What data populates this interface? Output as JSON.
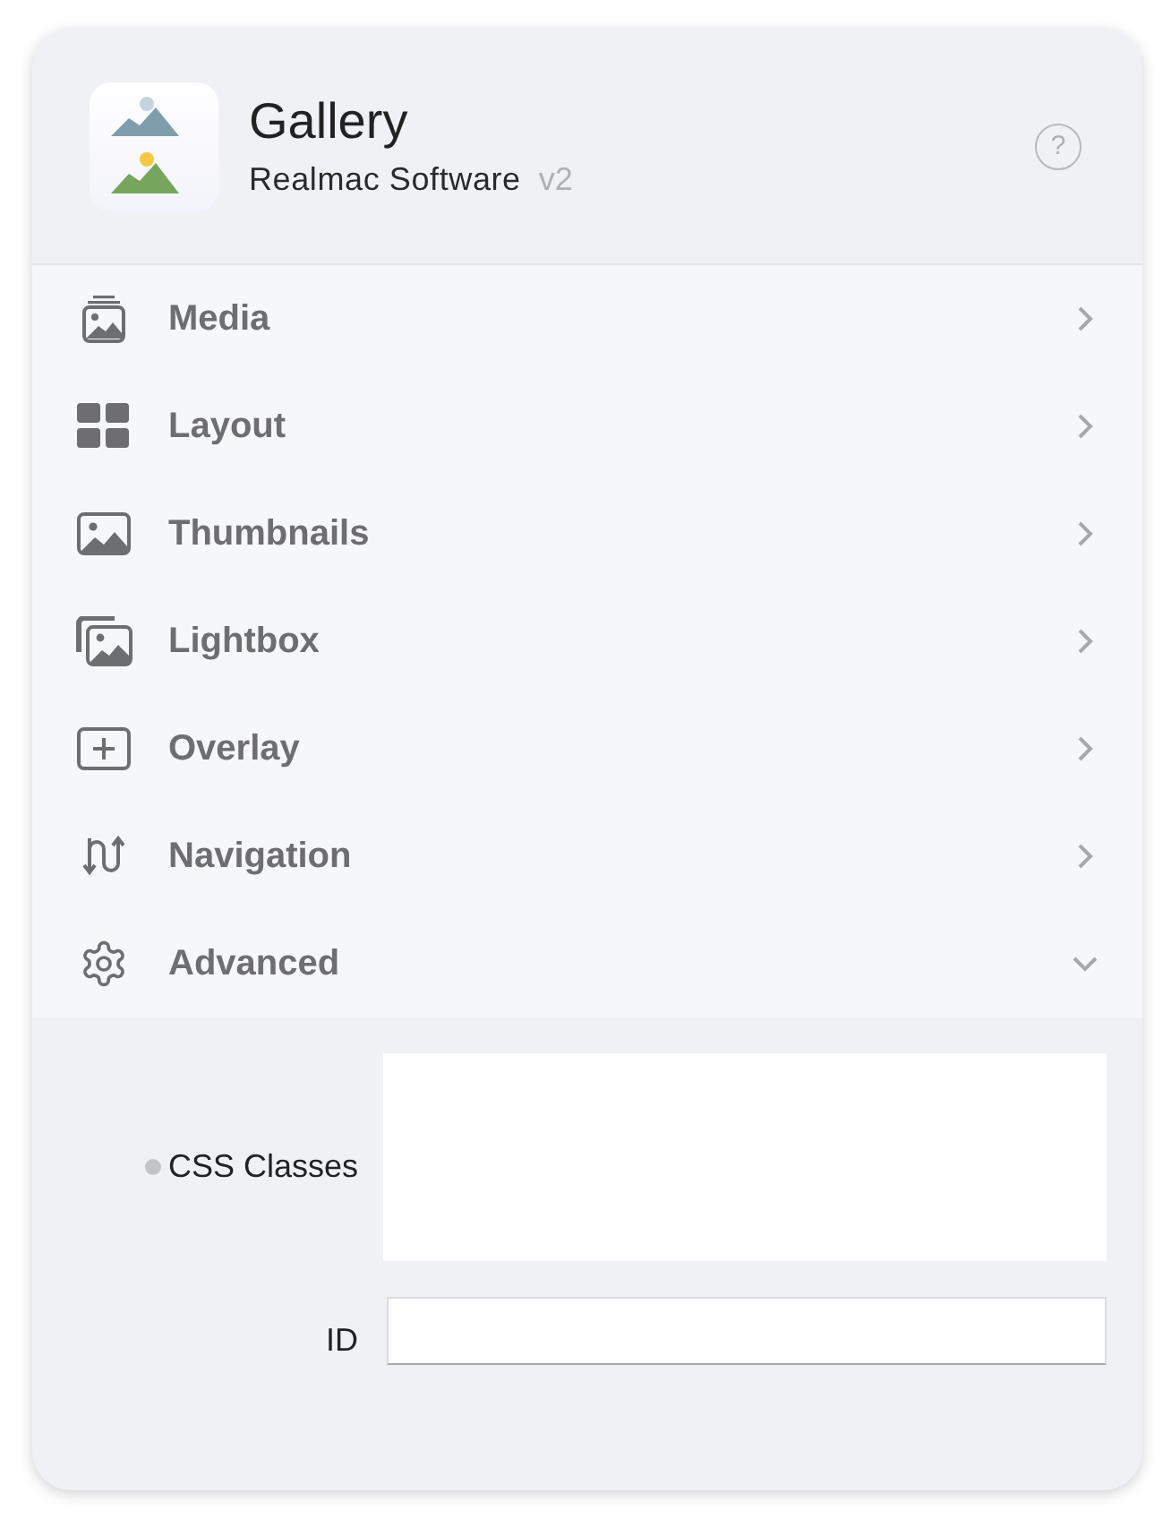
{
  "header": {
    "title": "Gallery",
    "vendor": "Realmac Software",
    "version": "v2",
    "help": "?"
  },
  "sections": [
    {
      "label": "Media",
      "expanded": false
    },
    {
      "label": "Layout",
      "expanded": false
    },
    {
      "label": "Thumbnails",
      "expanded": false
    },
    {
      "label": "Lightbox",
      "expanded": false
    },
    {
      "label": "Overlay",
      "expanded": false
    },
    {
      "label": "Navigation",
      "expanded": false
    },
    {
      "label": "Advanced",
      "expanded": true
    }
  ],
  "advanced_fields": [
    {
      "label": "CSS Classes",
      "kind": "textarea",
      "marked": true
    },
    {
      "label": "ID",
      "kind": "input",
      "marked": false
    }
  ]
}
